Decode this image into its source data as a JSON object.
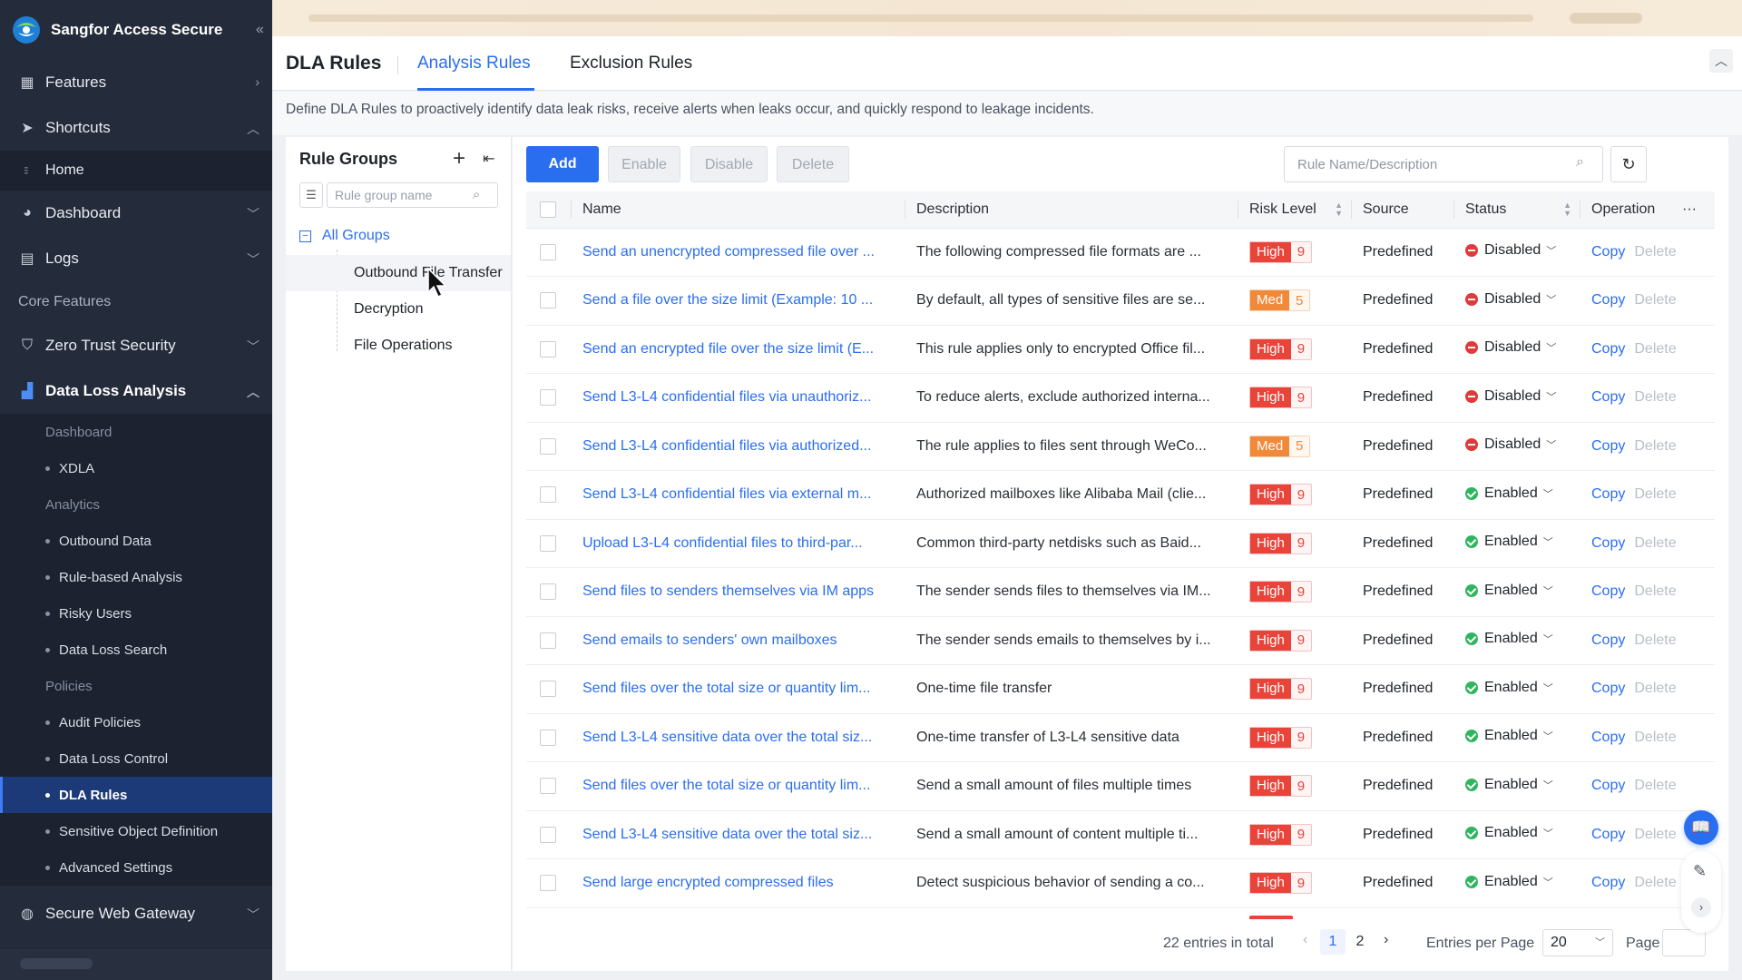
{
  "app": {
    "name": "Sangfor Access Secure",
    "collapse_icon": "double-chevron-left-icon"
  },
  "sidebar": {
    "features": "Features",
    "shortcuts": "Shortcuts",
    "home": "Home",
    "dashboard": "Dashboard",
    "logs": "Logs",
    "core_features": "Core Features",
    "zero_trust": "Zero Trust Security",
    "data_loss_analysis": "Data Loss Analysis",
    "dla_sub": {
      "dashboard_heading": "Dashboard",
      "xdla": "XDLA",
      "analytics_heading": "Analytics",
      "outbound_data": "Outbound Data",
      "rule_based": "Rule-based Analysis",
      "risky_users": "Risky Users",
      "data_loss_search": "Data Loss Search",
      "policies_heading": "Policies",
      "audit_policies": "Audit Policies",
      "data_loss_control": "Data Loss Control",
      "dla_rules": "DLA Rules",
      "sensitive_object": "Sensitive Object Definition",
      "advanced_settings": "Advanced Settings"
    },
    "secure_web_gateway": "Secure Web Gateway"
  },
  "header": {
    "title": "DLA Rules",
    "tabs": {
      "analysis": "Analysis Rules",
      "exclusion": "Exclusion Rules"
    },
    "description": "Define DLA Rules to proactively identify data leak risks, receive alerts when leaks occur, and quickly respond to leakage incidents."
  },
  "groups": {
    "title": "Rule Groups",
    "search_placeholder": "Rule group name",
    "root": "All Groups",
    "children": [
      "Outbound File Transfer",
      "Decryption",
      "File Operations"
    ]
  },
  "toolbar": {
    "add": "Add",
    "enable": "Enable",
    "disable": "Disable",
    "delete": "Delete",
    "search_placeholder": "Rule Name/Description"
  },
  "table": {
    "columns": {
      "name": "Name",
      "description": "Description",
      "risk": "Risk Level",
      "source": "Source",
      "status": "Status",
      "operation": "Operation",
      "more": "···"
    },
    "ops": {
      "copy": "Copy",
      "delete": "Delete"
    },
    "rows": [
      {
        "name": "Send an unencrypted compressed file over ...",
        "desc": "The following compressed file formats are ...",
        "risk": "High",
        "score": "9",
        "level": "high",
        "source": "Predefined",
        "status": "Disabled",
        "state": "disabled"
      },
      {
        "name": "Send a file over the size limit (Example: 10 ...",
        "desc": "By default, all types of sensitive files are se...",
        "risk": "Med",
        "score": "5",
        "level": "med",
        "source": "Predefined",
        "status": "Disabled",
        "state": "disabled"
      },
      {
        "name": "Send an encrypted file over the size limit (E...",
        "desc": "This rule applies only to encrypted Office fil...",
        "risk": "High",
        "score": "9",
        "level": "high",
        "source": "Predefined",
        "status": "Disabled",
        "state": "disabled"
      },
      {
        "name": "Send L3-L4 confidential files via unauthoriz...",
        "desc": "To reduce alerts, exclude authorized interna...",
        "risk": "High",
        "score": "9",
        "level": "high",
        "source": "Predefined",
        "status": "Disabled",
        "state": "disabled"
      },
      {
        "name": "Send L3-L4 confidential files via authorized...",
        "desc": "The rule applies to files sent through WeCo...",
        "risk": "Med",
        "score": "5",
        "level": "med",
        "source": "Predefined",
        "status": "Disabled",
        "state": "disabled"
      },
      {
        "name": "Send L3-L4 confidential files via external m...",
        "desc": "Authorized mailboxes like Alibaba Mail (clie...",
        "risk": "High",
        "score": "9",
        "level": "high",
        "source": "Predefined",
        "status": "Enabled",
        "state": "enabled"
      },
      {
        "name": "Upload L3-L4 confidential files to third-par...",
        "desc": "Common third-party netdisks such as Baid...",
        "risk": "High",
        "score": "9",
        "level": "high",
        "source": "Predefined",
        "status": "Enabled",
        "state": "enabled"
      },
      {
        "name": "Send files to senders themselves via IM apps",
        "desc": "The sender sends files to themselves via IM...",
        "risk": "High",
        "score": "9",
        "level": "high",
        "source": "Predefined",
        "status": "Enabled",
        "state": "enabled"
      },
      {
        "name": "Send emails to senders' own mailboxes",
        "desc": "The sender sends emails to themselves by i...",
        "risk": "High",
        "score": "9",
        "level": "high",
        "source": "Predefined",
        "status": "Enabled",
        "state": "enabled"
      },
      {
        "name": "Send files over the total size or quantity lim...",
        "desc": "One-time file transfer",
        "risk": "High",
        "score": "9",
        "level": "high",
        "source": "Predefined",
        "status": "Enabled",
        "state": "enabled"
      },
      {
        "name": "Send L3-L4 sensitive data over the total siz...",
        "desc": "One-time transfer of L3-L4 sensitive data",
        "risk": "High",
        "score": "9",
        "level": "high",
        "source": "Predefined",
        "status": "Enabled",
        "state": "enabled"
      },
      {
        "name": "Send files over the total size or quantity lim...",
        "desc": "Send a small amount of files multiple times",
        "risk": "High",
        "score": "9",
        "level": "high",
        "source": "Predefined",
        "status": "Enabled",
        "state": "enabled"
      },
      {
        "name": "Send L3-L4 sensitive data over the total siz...",
        "desc": "Send a small amount of content multiple ti...",
        "risk": "High",
        "score": "9",
        "level": "high",
        "source": "Predefined",
        "status": "Enabled",
        "state": "enabled"
      },
      {
        "name": "Send large encrypted compressed files",
        "desc": "Detect suspicious behavior of sending a co...",
        "risk": "High",
        "score": "9",
        "level": "high",
        "source": "Predefined",
        "status": "Enabled",
        "state": "enabled"
      }
    ]
  },
  "pagination": {
    "total": "22 entries in total",
    "pages": [
      "1",
      "2"
    ],
    "current": "1",
    "per_page_label": "Entries per Page",
    "per_page": "20",
    "page_label": "Page"
  },
  "colors": {
    "accent": "#2a6ef0",
    "sidebar_bg": "#242b3a",
    "high": "#e8443a",
    "med": "#f08a3a",
    "enabled": "#2fb55e",
    "disabled": "#e03a3a"
  }
}
